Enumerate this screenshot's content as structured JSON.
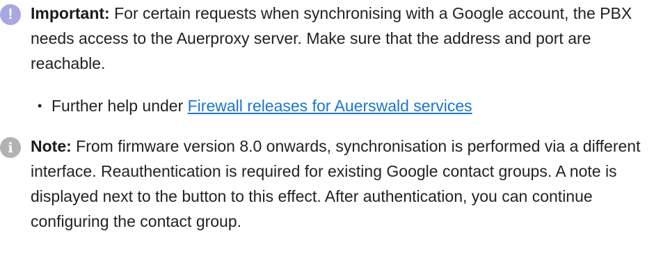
{
  "important": {
    "icon": "exclamation-circle-icon",
    "icon_glyph": "!",
    "label": "Important:",
    "text": " For certain requests when synchronising with a Google account, the PBX needs access to the Auerproxy server. Make sure that the address and port are reachable.",
    "bullet": {
      "prefix": "Further help under ",
      "link_text": "Firewall releases for Auerswald services"
    }
  },
  "note": {
    "icon": "info-circle-icon",
    "icon_glyph": "i",
    "label": "Note:",
    "text": " From firmware version 8.0 onwards, synchronisation is performed via a different interface. Reauthentication is required for existing Google contact groups. A note is displayed next to the button to this effect. After authentication, you can continue configuring the contact group."
  },
  "colors": {
    "important_icon": "#a9a7e1",
    "note_icon": "#b2b2b2",
    "link": "#1a75d1",
    "text": "#222222"
  }
}
